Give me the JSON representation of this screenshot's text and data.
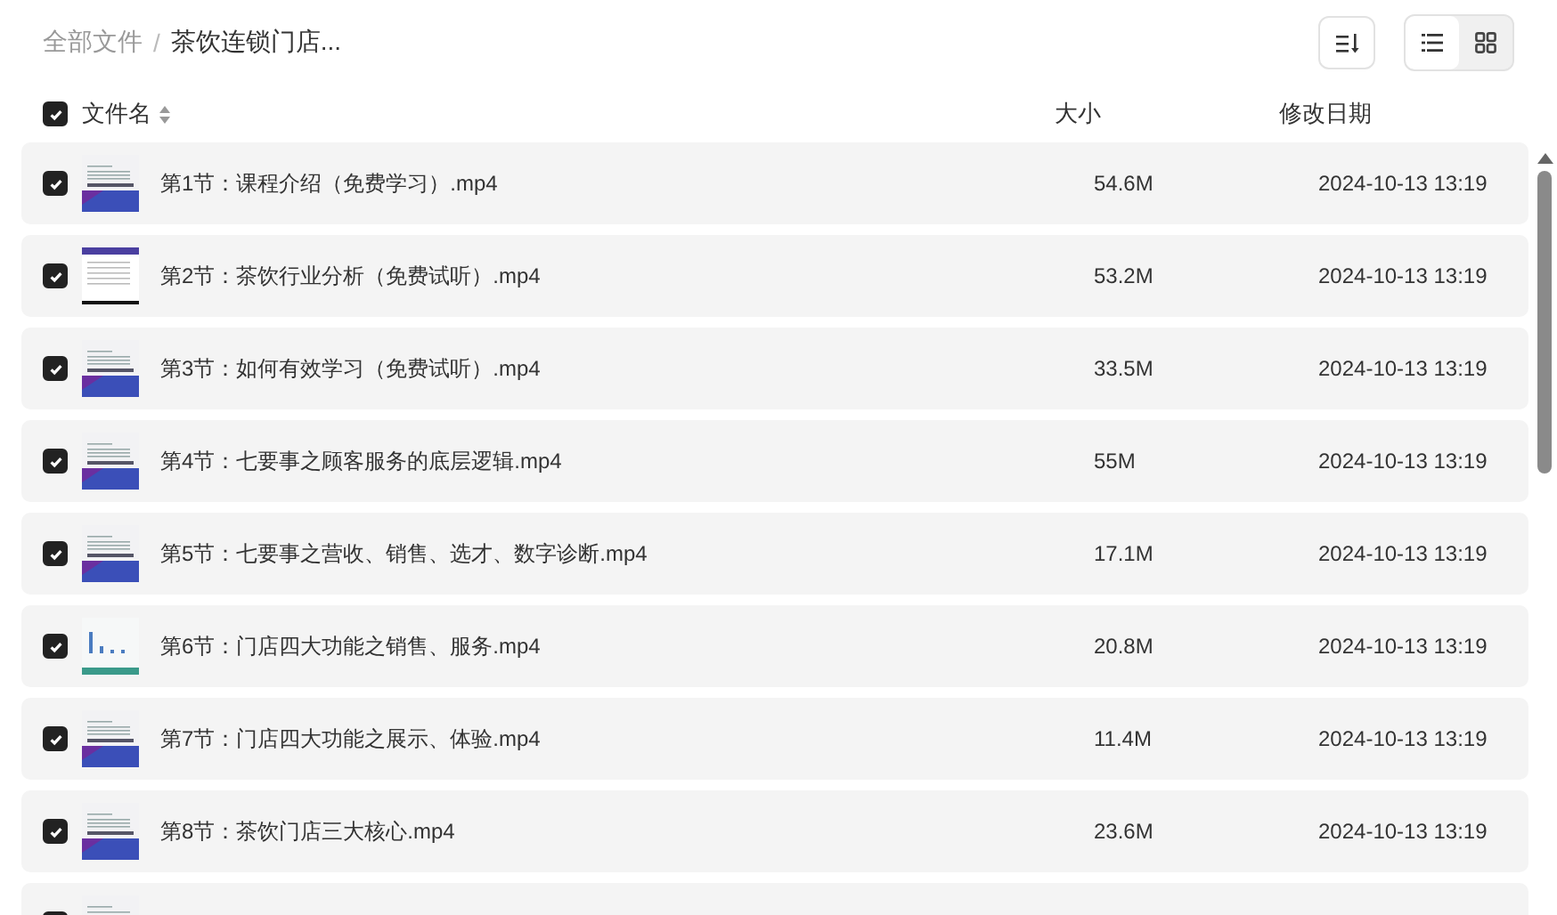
{
  "breadcrumb": {
    "separator": "/",
    "items": [
      {
        "label": "全部文件",
        "current": false
      },
      {
        "label": "茶饮连锁门店...",
        "current": true
      }
    ]
  },
  "toolbar": {
    "view_modes": [
      {
        "kind": "list",
        "selected": true
      },
      {
        "kind": "grid",
        "selected": false
      }
    ]
  },
  "header": {
    "checked": true,
    "columns": [
      "文件名",
      "大小",
      "修改日期"
    ]
  },
  "rows": [
    {
      "checked": true,
      "kind": "title-slide",
      "name": "第1节：课程介绍（免费学习）.mp4",
      "size": "54.6M",
      "date": "2024-10-13 13:19"
    },
    {
      "checked": true,
      "kind": "text-slide",
      "name": "第2节：茶饮行业分析（免费试听）.mp4",
      "size": "53.2M",
      "date": "2024-10-13 13:19"
    },
    {
      "checked": true,
      "kind": "title-slide",
      "name": "第3节：如何有效学习（免费试听）.mp4",
      "size": "33.5M",
      "date": "2024-10-13 13:19"
    },
    {
      "checked": true,
      "kind": "title-slide",
      "name": "第4节：七要事之顾客服务的底层逻辑.mp4",
      "size": "55M",
      "date": "2024-10-13 13:19"
    },
    {
      "checked": true,
      "kind": "title-slide",
      "name": "第5节：七要事之营收、销售、选才、数字诊断.mp4",
      "size": "17.1M",
      "date": "2024-10-13 13:19"
    },
    {
      "checked": true,
      "kind": "chart-slide",
      "name": "第6节：门店四大功能之销售、服务.mp4",
      "size": "20.8M",
      "date": "2024-10-13 13:19"
    },
    {
      "checked": true,
      "kind": "title-slide",
      "name": "第7节：门店四大功能之展示、体验.mp4",
      "size": "11.4M",
      "date": "2024-10-13 13:19"
    },
    {
      "checked": true,
      "kind": "title-slide",
      "name": "第8节：茶饮门店三大核心.mp4",
      "size": "23.6M",
      "date": "2024-10-13 13:19"
    },
    {
      "checked": true,
      "kind": "title-slide"
    }
  ]
}
